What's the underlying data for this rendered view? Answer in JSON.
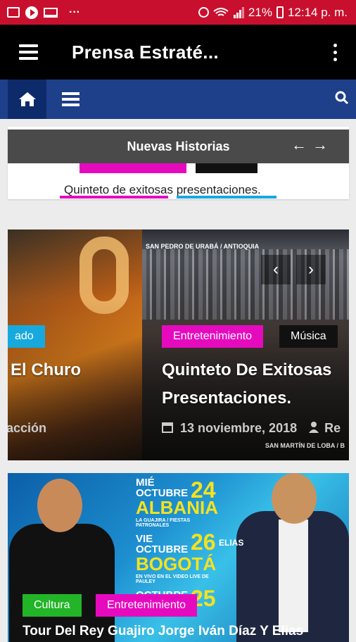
{
  "status_bar": {
    "battery": "21%",
    "time": "12:14 p. m.",
    "more": "···"
  },
  "app_bar": {
    "title": "Prensa Estraté..."
  },
  "ticker": {
    "heading": "Nuevas Historias",
    "text": "Quinteto de exitosas presentaciones.",
    "prev": "←",
    "next": "→"
  },
  "slider": {
    "prev_slide": {
      "category": "ado",
      "title": "El Churo",
      "author": "acción"
    },
    "current_slide": {
      "location_top": "SAN PEDRO DE URABÁ / ANTIOQUIA",
      "location_bottom": "SAN MARTÍN DE LOBA / B",
      "categories": [
        "Entretenimiento",
        "Música"
      ],
      "title": "Quinteto De Exitosas Presentaciones.",
      "date": "13 noviembre, 2018",
      "author": "Re"
    },
    "arrow_prev": "‹",
    "arrow_next": "›"
  },
  "article_card": {
    "categories": [
      "Cultura",
      "Entretenimiento"
    ],
    "title": "Tour Del Rey Guajiro Jorge Iván Díaz Y Elías",
    "poster": [
      {
        "day": "MIÉ",
        "month": "OCTUBRE",
        "num": "24",
        "city": "ALBANIA",
        "sub": "LA GUAJIRA / FIESTAS PATRONALES"
      },
      {
        "day": "VIE",
        "month": "OCTUBRE",
        "num": "26",
        "city": "BOGOTÁ",
        "sub": "EN VIVO EN EL VIDEO LIVE DE PAULEY"
      },
      {
        "day": "",
        "month": "OCTUBRE",
        "num": "25",
        "city": "",
        "sub": ""
      }
    ],
    "name_tag": "ELIAS"
  },
  "colors": {
    "status_bar": "#c8102e",
    "nav_bar": "#1e3f8a",
    "magenta": "#e60abf",
    "cyan": "#17a9de",
    "green": "#22b527"
  }
}
